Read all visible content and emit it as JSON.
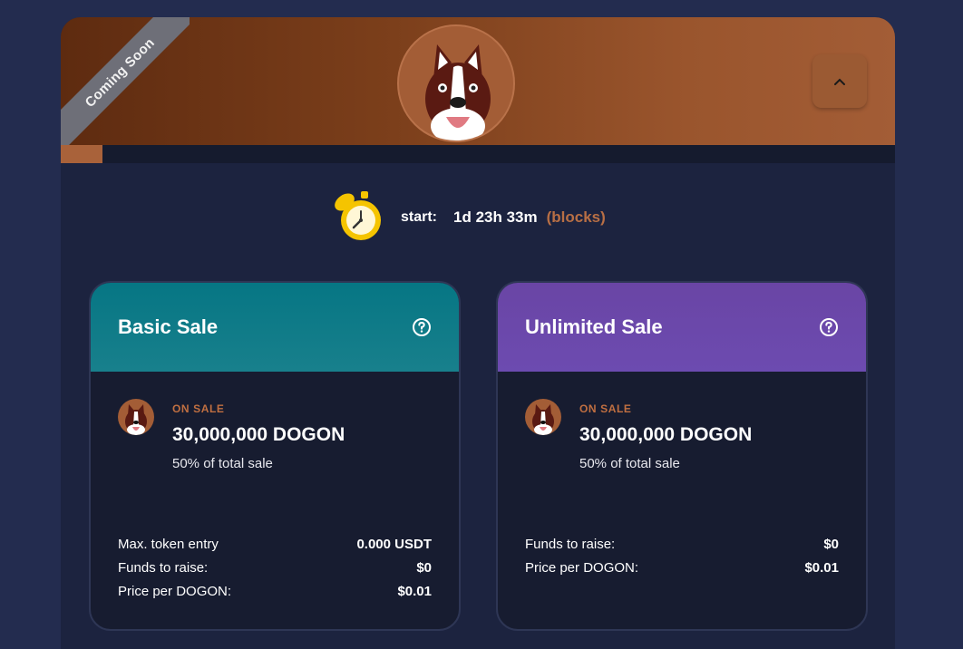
{
  "banner": {
    "ribbon_text": "Coming Soon",
    "collapse_icon": "chevron-up-icon",
    "accent_color": "#a35d36",
    "progress_percent": 5
  },
  "timer": {
    "icon": "stopwatch-icon",
    "label": "start:",
    "value": "1d 23h 33m",
    "blocks_link": "(blocks)"
  },
  "sales": {
    "basic": {
      "title": "Basic Sale",
      "header_color": "#0e7b88",
      "on_sale_label": "ON SALE",
      "amount": "30,000,000 DOGON",
      "share": "50% of total sale",
      "stats": [
        {
          "label": "Max. token entry",
          "value": "0.000 USDT"
        },
        {
          "label": "Funds to raise:",
          "value": "$0"
        },
        {
          "label": "Price per DOGON:",
          "value": "$0.01"
        }
      ]
    },
    "unlimited": {
      "title": "Unlimited Sale",
      "header_color": "#6a48aa",
      "on_sale_label": "ON SALE",
      "amount": "30,000,000 DOGON",
      "share": "50% of total sale",
      "stats": [
        {
          "label": "Funds to raise:",
          "value": "$0"
        },
        {
          "label": "Price per DOGON:",
          "value": "$0.01"
        }
      ]
    }
  }
}
